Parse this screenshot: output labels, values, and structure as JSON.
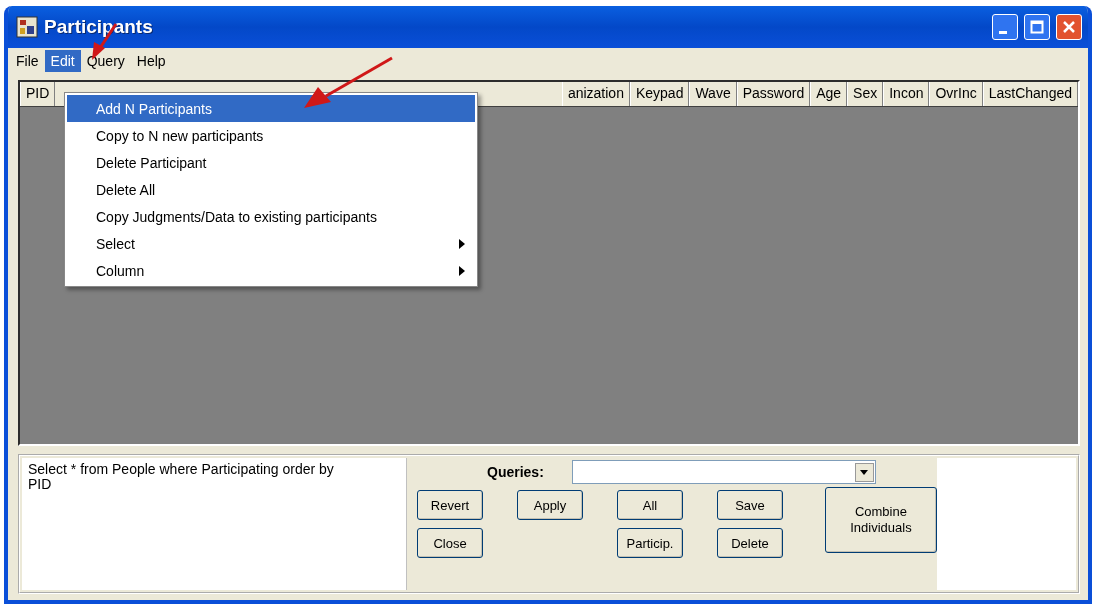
{
  "window": {
    "title": "Participants"
  },
  "menu_bar": [
    {
      "label": "File",
      "selected": false
    },
    {
      "label": "Edit",
      "selected": true
    },
    {
      "label": "Query",
      "selected": false
    },
    {
      "label": "Help",
      "selected": false
    }
  ],
  "edit_menu": [
    {
      "label": "Add N Participants",
      "selected": true,
      "submenu": false
    },
    {
      "label": "Copy to N new participants",
      "selected": false,
      "submenu": false
    },
    {
      "label": "Delete Participant",
      "selected": false,
      "submenu": false
    },
    {
      "label": "Delete All",
      "selected": false,
      "submenu": false
    },
    {
      "label": "Copy Judgments/Data to existing participants",
      "selected": false,
      "submenu": false
    },
    {
      "label": "Select",
      "selected": false,
      "submenu": true
    },
    {
      "label": "Column",
      "selected": false,
      "submenu": true
    }
  ],
  "table": {
    "columns": [
      "PID",
      "anization",
      "Keypad",
      "Wave",
      "Password",
      "Age",
      "Sex",
      "Incon",
      "OvrInc",
      "LastChanged"
    ]
  },
  "query_panel": {
    "query_text": "Select * from People where Participating order by PID",
    "queries_label": "Queries:",
    "button_rows": [
      {
        "buttons": [
          "Revert",
          "Apply",
          "All",
          "Save"
        ]
      },
      {
        "buttons": [
          "Close",
          "Particip.",
          "Delete"
        ]
      }
    ],
    "side_button": "Combine Individuals"
  }
}
